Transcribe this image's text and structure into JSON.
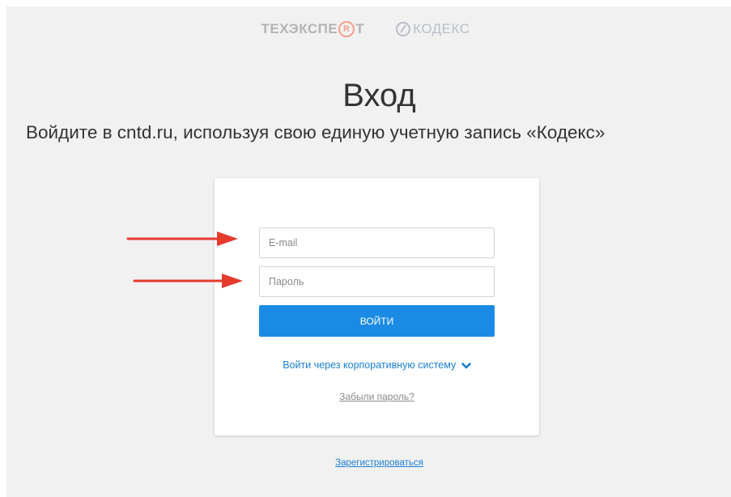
{
  "brand": {
    "logo_left": "ТЕХЭКСПЕ",
    "logo_left_r": "R",
    "logo_left_end": "Т",
    "logo_right": "КОДЕКС"
  },
  "header": {
    "title": "Вход",
    "subtitle": "Войдите в cntd.ru, используя свою единую учетную запись «Кодекс»"
  },
  "form": {
    "email_placeholder": "E-mail",
    "password_placeholder": "Пароль",
    "login_label": "ВОЙТИ",
    "corporate_label": "Войти через корпоративную систему",
    "forgot_label": "Забыли пароль?"
  },
  "footer": {
    "register_label": "Зарегистрироваться"
  },
  "colors": {
    "accent": "#1a8ae5",
    "link": "#1a7fd4",
    "background": "#f1f1f1",
    "annotation_arrow": "#e53a2e"
  },
  "icons": [
    "chevron-down-icon",
    "arrow-annotation-icon",
    "kodeks-logo-icon"
  ]
}
